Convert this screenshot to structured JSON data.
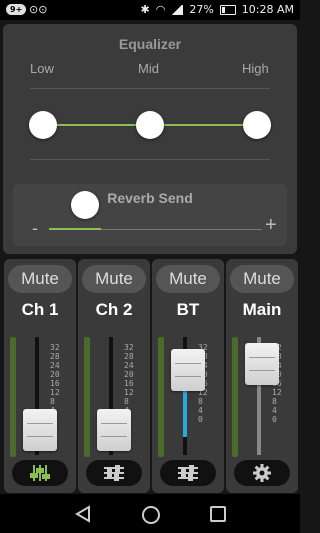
{
  "statusbar": {
    "notification_badge": "9+",
    "battery_percent": "27%",
    "time": "10:28 AM",
    "icons": [
      "voicemail-icon",
      "bluetooth-icon",
      "wifi-icon",
      "signal-icon",
      "battery-icon"
    ]
  },
  "equalizer": {
    "title": "Equalizer",
    "labels": [
      "Low",
      "Mid",
      "High"
    ],
    "levels": {
      "low": 0.5,
      "mid": 0.5,
      "high": 0.5
    }
  },
  "reverb": {
    "title": "Reverb Send",
    "minus": "-",
    "plus": "+",
    "level": 0.25
  },
  "channels": [
    {
      "mute": "Mute",
      "name": "Ch 1",
      "fader_level": 0.1,
      "setting_icon": "equalizer-icon",
      "accent": "#8bbf53"
    },
    {
      "mute": "Mute",
      "name": "Ch 2",
      "fader_level": 0.1,
      "setting_icon": "sliders-icon",
      "accent": "#cccccc"
    },
    {
      "mute": "Mute",
      "name": "BT",
      "fader_level": 0.75,
      "setting_icon": "sliders-icon",
      "accent": "#cccccc"
    },
    {
      "mute": "Mute",
      "name": "Main",
      "fader_level": 0.75,
      "setting_icon": "gear-icon",
      "accent": "#cccccc"
    }
  ],
  "fader_ticks": [
    "32",
    "28",
    "24",
    "20",
    "16",
    "12",
    "8",
    "4",
    "0"
  ],
  "colors": {
    "accent_green": "#8bbf53",
    "fader_blue": "#2aa9d8"
  }
}
